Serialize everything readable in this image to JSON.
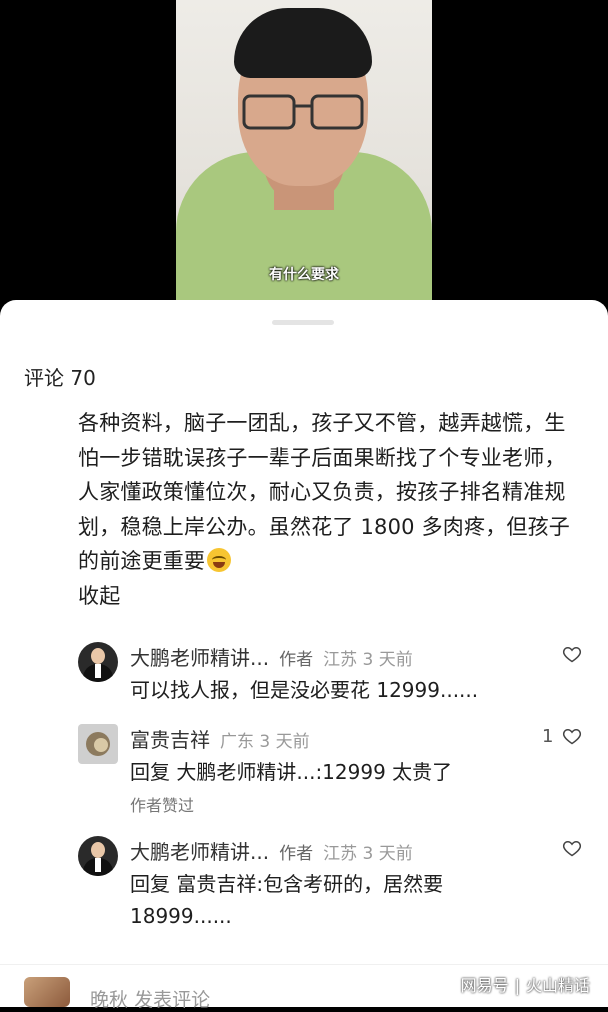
{
  "video": {
    "subtitle": "有什么要求"
  },
  "comments_panel": {
    "title": "评论 70",
    "main_comment": {
      "text": "各种资料，脑子一团乱，孩子又不管，越弄越慌，生怕一步错耽误孩子一辈子后面果断找了个专业老师，人家懂政策懂位次，耐心又负责，按孩子排名精准规划，稳稳上岸公办。虽然花了 1800 多肉疼，但孩子的前途更重要",
      "emoji": "face-with-tears-of-joy",
      "collapse_label": "收起"
    },
    "replies": [
      {
        "name": "大鹏老师精讲...",
        "tag": "作者",
        "meta": "江苏 3 天前",
        "reply_prefix": "",
        "reply_to": "",
        "text": "可以找人报，但是没必要花 12999......",
        "likes": "",
        "liked_by_author": ""
      },
      {
        "name": "富贵吉祥",
        "tag": "",
        "meta": "广东 3 天前",
        "reply_prefix": "回复",
        "reply_to": "大鹏老师精讲...",
        "text": ":12999 太贵了",
        "likes": "1",
        "liked_by_author": "作者赞过"
      },
      {
        "name": "大鹏老师精讲...",
        "tag": "作者",
        "meta": "江苏 3 天前",
        "reply_prefix": "回复",
        "reply_to": "富贵吉祥",
        "text": ":包含考研的，居然要 18999......",
        "likes": "",
        "liked_by_author": ""
      }
    ]
  },
  "bottom_bar": {
    "user": "晚秋",
    "placeholder": "发表评论"
  },
  "watermark": {
    "left": "网易号",
    "right": "火山精话"
  },
  "icons": {
    "like": "heart-outline-icon"
  }
}
